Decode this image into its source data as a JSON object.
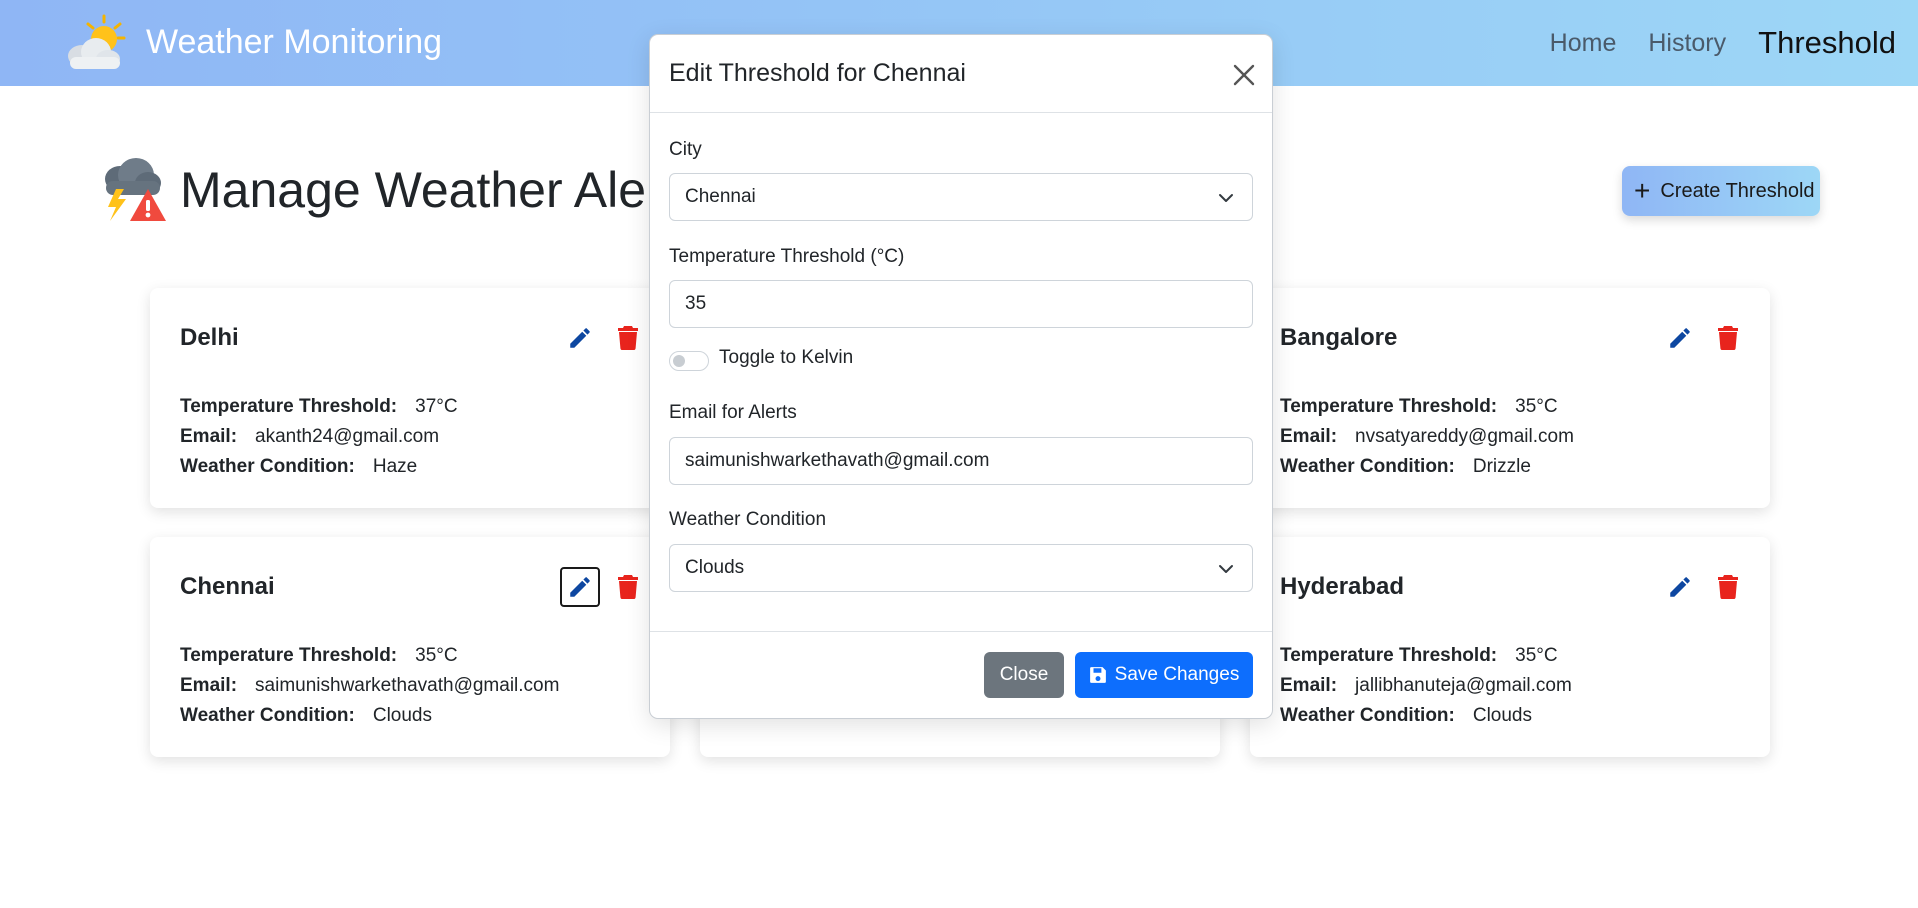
{
  "navbar": {
    "brand_text": "Weather Monitoring",
    "links": [
      {
        "label": "Home",
        "active": false
      },
      {
        "label": "History",
        "active": false
      },
      {
        "label": "Threshold",
        "active": true
      }
    ]
  },
  "page": {
    "title": "Manage Weather Alerts",
    "create_button_label": "Create Threshold"
  },
  "field_labels": {
    "temperature": "Temperature Threshold:",
    "email": "Email:",
    "condition": "Weather Condition:"
  },
  "cards": [
    {
      "city": "Delhi",
      "temperature": "37°C",
      "email": "akanth24@gmail.com",
      "condition": "Haze"
    },
    {
      "city": "Bangalore",
      "temperature": "35°C",
      "email": "nvsatyareddy@gmail.com",
      "condition": "Drizzle"
    },
    {
      "city": "Chennai",
      "temperature": "35°C",
      "email": "saimunishwarkethavath@gmail.com",
      "condition": "Clouds"
    },
    {
      "city": "Hyderabad",
      "temperature": "35°C",
      "email": "jallibhanuteja@gmail.com",
      "condition": "Clouds"
    }
  ],
  "modal": {
    "title": "Edit Threshold for Chennai",
    "city_label": "City",
    "city_value": "Chennai",
    "temperature_label": "Temperature Threshold (°C)",
    "temperature_value": "35",
    "toggle_label": "Toggle to Kelvin",
    "toggle_on": false,
    "email_label": "Email for Alerts",
    "email_value": "saimunishwarkethavath@gmail.com",
    "condition_label": "Weather Condition",
    "condition_value": "Clouds",
    "close_label": "Close",
    "save_label": "Save Changes"
  },
  "colors": {
    "navbar_gradient_start": "#8fb6f5",
    "navbar_gradient_end": "#9dd7f6",
    "edit_icon": "#0d47a1",
    "delete_icon": "#e8241d",
    "primary": "#0d6efd",
    "secondary": "#6c757d"
  }
}
